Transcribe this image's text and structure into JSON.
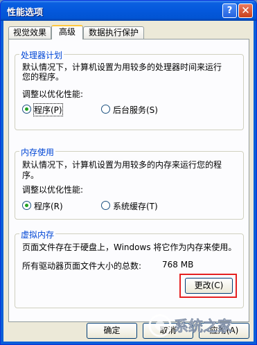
{
  "window": {
    "title": "性能选项",
    "help_glyph": "?",
    "close_glyph": "✕"
  },
  "tabs": [
    {
      "label": "视觉效果"
    },
    {
      "label": "高级"
    },
    {
      "label": "数据执行保护"
    }
  ],
  "processor": {
    "title": "处理器计划",
    "desc_line1": "默认情况下，计算机设置为用较多的处理器时间来运行",
    "desc_line2": "您的程序。",
    "adjust_label": "调整以优化性能:",
    "option1": "程序(P)",
    "option2": "后台服务(S)",
    "selected": "程序"
  },
  "memory": {
    "title": "内存使用",
    "desc_line1": "默认情况下，计算机设置为用较多的内存来运行您的程",
    "desc_line2": "序。",
    "adjust_label": "调整以优化性能:",
    "option1": "程序(R)",
    "option2": "系统缓存(T)",
    "selected": "程序"
  },
  "virtual_memory": {
    "title": "虚拟内存",
    "desc": "页面文件存在于硬盘上，Windows 将它作为内存来使用。",
    "total_label": "所有驱动器页面文件大小的总数:",
    "total_value": "768 MB",
    "change_button": "更改(C)"
  },
  "footer": {
    "ok": "确定",
    "cancel": "取消",
    "apply": "应用(A)"
  },
  "watermark": {
    "text": "系统之家"
  },
  "colors": {
    "group_title": "#0046d5",
    "highlight_box": "#e52020",
    "radio_dot": "#21a121"
  }
}
